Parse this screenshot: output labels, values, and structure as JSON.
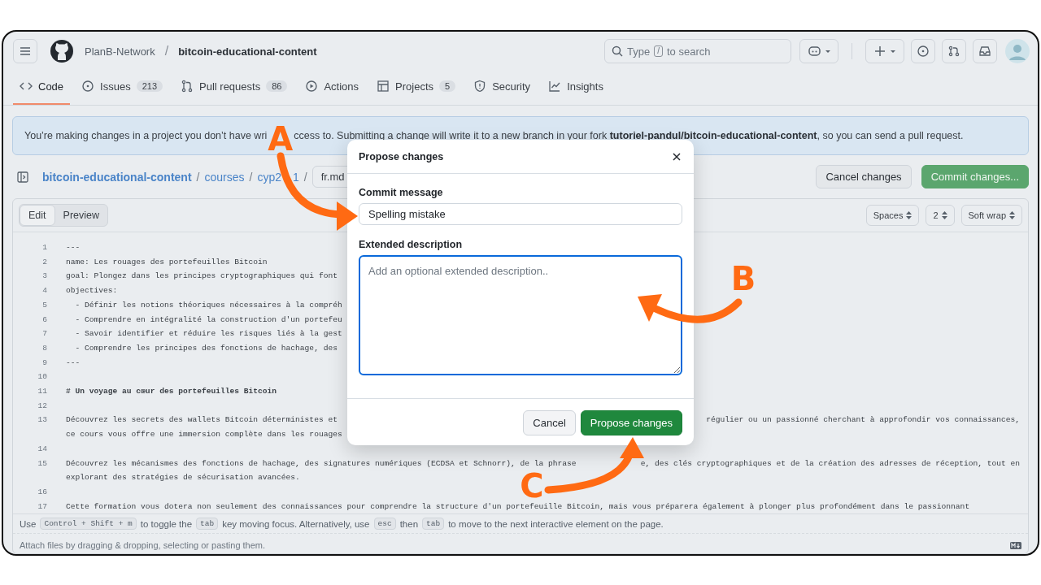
{
  "header": {
    "owner": "PlanB-Network",
    "separator": "/",
    "repo": "bitcoin-educational-content",
    "search": {
      "before": "Type",
      "key": "/",
      "after": "to search"
    }
  },
  "tabs": [
    {
      "label": "Code",
      "selected": true
    },
    {
      "label": "Issues",
      "count": "213",
      "selected": false
    },
    {
      "label": "Pull requests",
      "count": "86",
      "selected": false
    },
    {
      "label": "Actions",
      "selected": false
    },
    {
      "label": "Projects",
      "count": "5",
      "selected": false
    },
    {
      "label": "Security",
      "selected": false
    },
    {
      "label": "Insights",
      "selected": false
    }
  ],
  "banner": {
    "parts": [
      "You’re making changes in a project you don’t have wri",
      "ccess to. Submitting a change will write it to a new branch in your fork **tutoriel-pandul/bitcoin-educational-content**, so you can send a pull request."
    ]
  },
  "breadcrumb": {
    "path": [
      {
        "text": "bitcoin-educational-content",
        "kind": "link"
      },
      {
        "text": "/",
        "kind": "separator"
      },
      {
        "text": "courses",
        "kind": "link"
      },
      {
        "text": "/",
        "kind": "separator"
      },
      {
        "text": "cyp2",
        "kind": "link-cut"
      },
      {
        "text": "1",
        "kind": "link"
      },
      {
        "text": "/",
        "kind": "separator"
      }
    ],
    "filename": "fr.md"
  },
  "actions": [
    {
      "label": "Cancel changes",
      "kind": "secondary"
    },
    {
      "label": "Commit changes...",
      "kind": "primary"
    }
  ],
  "editor": {
    "modes": [
      {
        "label": "Edit",
        "selected": true
      },
      {
        "label": "Preview",
        "selected": false
      }
    ],
    "options": [
      {
        "label": "Spaces"
      },
      {
        "label": "2"
      },
      {
        "label": "Soft wrap"
      }
    ],
    "lines": [
      {
        "number": "1",
        "rows": [
          {
            "text": "---"
          }
        ]
      },
      {
        "number": "2",
        "rows": [
          {
            "text": "name: Les rouages des portefeuilles Bitcoin"
          }
        ]
      },
      {
        "number": "3",
        "rows": [
          {
            "text": "goal: Plongez dans les principes cryptographiques qui font"
          }
        ]
      },
      {
        "number": "4",
        "rows": [
          {
            "text": "objectives:"
          }
        ]
      },
      {
        "number": "5",
        "rows": [
          {
            "text": "  - Définir les notions théoriques nécessaires à la compréh"
          }
        ]
      },
      {
        "number": "6",
        "rows": [
          {
            "text": "  - Comprendre en intégralité la construction d'un portefeu"
          }
        ]
      },
      {
        "number": "7",
        "rows": [
          {
            "text": "  - Savoir identifier et réduire les risques liés à la gest"
          }
        ]
      },
      {
        "number": "8",
        "rows": [
          {
            "text": "  - Comprendre les principes des fonctions de hachage, des"
          }
        ]
      },
      {
        "number": "9",
        "rows": [
          {
            "text": "---"
          }
        ]
      },
      {
        "number": "10"
      },
      {
        "number": "11",
        "kind": "heading",
        "rows": [
          {
            "text": "# Un voyage au cœur des portefeuilles Bitcoin"
          }
        ]
      },
      {
        "number": "12"
      },
      {
        "number": "13",
        "rows": [
          {
            "text": "Découvrez les secrets des wallets Bitcoin déterministes et",
            "tail": "régulier ou un passionné cherchant à approfondir vos connaissances,"
          },
          {
            "text": "ce cours vous offre une immersion complète dans les rouages"
          }
        ]
      },
      {
        "number": "14"
      },
      {
        "number": "15",
        "rows": [
          {
            "text": "Découvrez les mécanismes des fonctions de hachage, des signatures numériques (ECDSA et Schnorr), de la phrase",
            "tail": "e, des clés cryptographiques et de la création des adresses de réception, tout en"
          },
          {
            "text": "explorant des stratégies de sécurisation avancées."
          }
        ]
      },
      {
        "number": "16"
      },
      {
        "number": "17",
        "rows": [
          {
            "text": "Cette formation vous dotera non seulement des connaissances pour comprendre la structure d'un portefeuille Bitcoin, mais vous préparera également à plonger plus profondément dans le passionnant"
          }
        ]
      }
    ],
    "hint": [
      {
        "kind": "text",
        "text": "Use"
      },
      {
        "kind": "key",
        "text": "Control + Shift + m"
      },
      {
        "kind": "text",
        "text": "to toggle the"
      },
      {
        "kind": "key",
        "text": "tab"
      },
      {
        "kind": "text",
        "text": "key moving focus. Alternatively, use"
      },
      {
        "kind": "key",
        "text": "esc"
      },
      {
        "kind": "text",
        "text": "then"
      },
      {
        "kind": "key",
        "text": "tab"
      },
      {
        "kind": "text",
        "text": "to move to the next interactive element on the page."
      }
    ],
    "attach": "Attach files by dragging & dropping, selecting or pasting them."
  },
  "dialog": {
    "title": "Propose changes",
    "message_label": "Commit message",
    "message": "Spelling mistake",
    "description_label": "Extended description",
    "description_placeholder": "Add an optional extended description..",
    "buttons": [
      {
        "label": "Cancel",
        "kind": "secondary"
      },
      {
        "label": "Propose changes",
        "kind": "primary"
      }
    ]
  },
  "annotations": [
    {
      "label": "A"
    },
    {
      "label": "B"
    },
    {
      "label": "C"
    }
  ]
}
